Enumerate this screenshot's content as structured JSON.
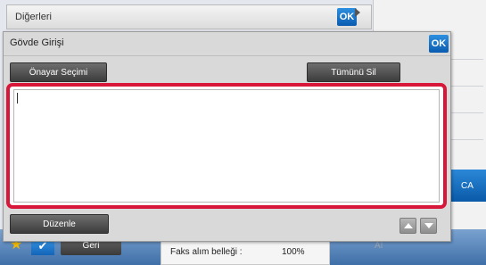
{
  "background": {
    "title": "Diğerleri",
    "ok_label": "OK",
    "ca_label": "CA",
    "back_label": "Geri",
    "status_label": "Faks alım belleği :",
    "status_value": "100%",
    "ai_label": "AI"
  },
  "dialog": {
    "title": "Gövde Girişi",
    "ok_label": "OK",
    "approver_button": "Önayar Seçimi",
    "clear_all_button": "Tümünü Sil",
    "body_text": "",
    "edit_button": "Düzenle"
  },
  "colors": {
    "highlight": "#d8163a",
    "ok_blue": "#0a5cb0",
    "star": "#f2b800"
  },
  "icons": {
    "star": "star-icon",
    "check": "check-icon",
    "scroll_up": "arrow-up-icon",
    "scroll_down": "arrow-down-icon",
    "next": "play-arrow-icon"
  }
}
